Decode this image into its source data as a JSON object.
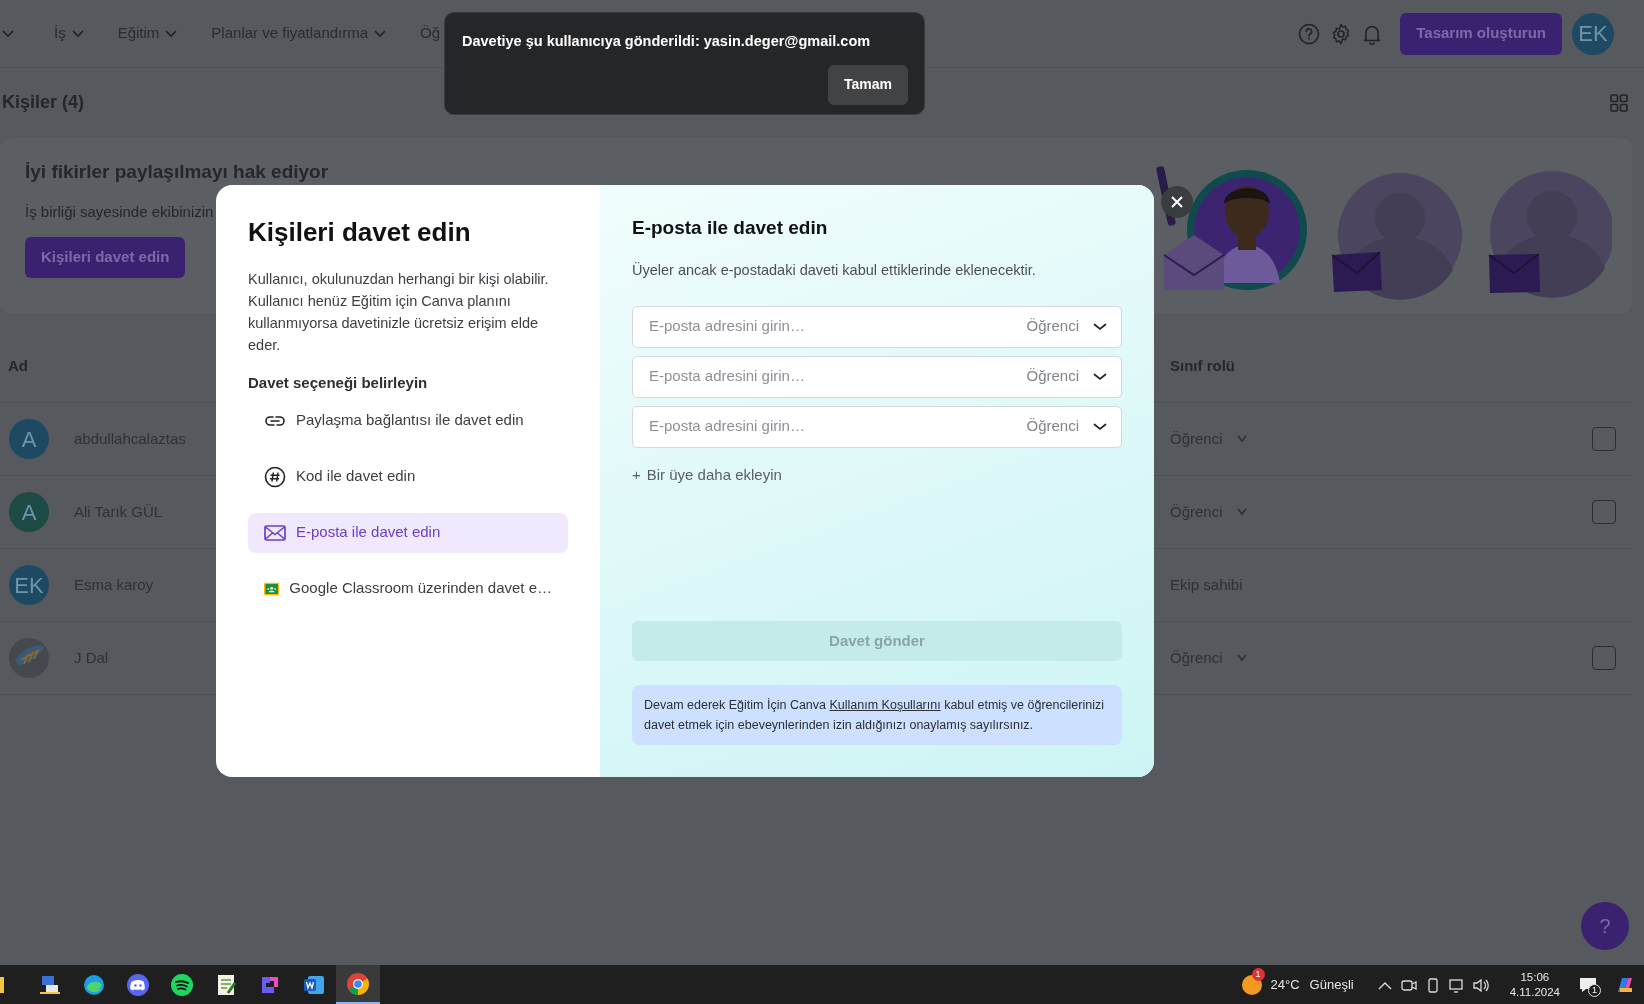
{
  "top_nav": {
    "menus": [
      {
        "label": "İş",
        "caret": true
      },
      {
        "label": "Eğitim",
        "caret": true
      },
      {
        "label": "Planlar ve fiyatlandırma",
        "caret": true
      },
      {
        "label": "Öğ",
        "caret": false
      }
    ],
    "create_button": "Tasarım oluşturun",
    "avatar": "EK"
  },
  "toast": {
    "message": "Davetiye şu kullanıcıya gönderildi: yasin.deger@gmail.com",
    "button": "Tamam"
  },
  "page": {
    "title": "Kişiler (4)"
  },
  "banner": {
    "title": "İyi fikirler paylaşılmayı hak ediyor",
    "text": "İş birliği sayesinde ekibinizin",
    "button": "Kişileri davet edin"
  },
  "table": {
    "columns": [
      "Ad",
      "Sınıf rolü"
    ],
    "rows": [
      {
        "kind": "initials",
        "avatar": "A",
        "color": "#1d4a62",
        "name": "abdullahcalaztas",
        "role": "Öğrenci",
        "editable": true,
        "checked": false
      },
      {
        "kind": "initials",
        "avatar": "A",
        "color": "#1d4a45",
        "name": "Ali Tarık GÜL",
        "role": "Öğrenci",
        "editable": true,
        "checked": false
      },
      {
        "kind": "initials",
        "avatar": "EK",
        "color": "#1d4a62",
        "name": "Esma karoy",
        "role": "Ekip sahibi",
        "editable": false
      },
      {
        "kind": "picture",
        "name": "J Dal",
        "role": "Öğrenci",
        "editable": true,
        "checked": false
      }
    ]
  },
  "modal": {
    "title": "Kişileri davet edin",
    "description": "Kullanıcı, okulunuzdan herhangi bir kişi olabilir. Kullanıcı henüz Eğitim için Canva planını kullanmıyorsa davetinizle ücretsiz erişim elde eder.",
    "options_heading": "Davet seçeneği belirleyin",
    "options": [
      {
        "kind": "link",
        "label": "Paylaşma bağlantısı ile davet edin",
        "selected": false
      },
      {
        "kind": "code",
        "label": "Kod ile davet edin",
        "selected": false
      },
      {
        "kind": "email",
        "label": "E-posta ile davet edin",
        "selected": true
      },
      {
        "kind": "classroom",
        "label": "Google Classroom üzerinden davet e…",
        "selected": false
      }
    ],
    "panel": {
      "title": "E-posta ile davet edin",
      "subtitle": "Üyeler ancak e-postadaki daveti kabul ettiklerinde eklenecektir.",
      "fields": [
        {
          "placeholder": "E-posta adresini girin…",
          "role": "Öğrenci"
        },
        {
          "placeholder": "E-posta adresini girin…",
          "role": "Öğrenci"
        },
        {
          "placeholder": "E-posta adresini girin…",
          "role": "Öğrenci"
        }
      ],
      "add_icon": "+",
      "add_link": "Bir üye daha ekleyin",
      "submit": {
        "label": "Davet gönder",
        "disabled": true
      },
      "notice_before": "Devam ederek Eğitim İçin Canva ",
      "notice_link": "Kullanım Koşullarını",
      "notice_after": " kabul etmiş ve öğrencilerinizi davet etmek için ebeveynlerinden izin aldığınızı onaylamış sayılırsınız."
    }
  },
  "help_button": "?",
  "taskbar": {
    "apps": [
      {
        "kind": "network",
        "selected": false
      },
      {
        "kind": "edge",
        "selected": false
      },
      {
        "kind": "discord",
        "selected": false
      },
      {
        "kind": "spotify",
        "selected": false
      },
      {
        "kind": "notepad",
        "selected": false
      },
      {
        "kind": "puzzle",
        "selected": false
      },
      {
        "kind": "word",
        "selected": false
      },
      {
        "kind": "chrome",
        "selected": true
      }
    ],
    "weather_badge": "1",
    "temperature": "24°C",
    "condition": "Güneşli",
    "time": "15:06",
    "date": "4.11.2024",
    "notification_count": "1"
  }
}
